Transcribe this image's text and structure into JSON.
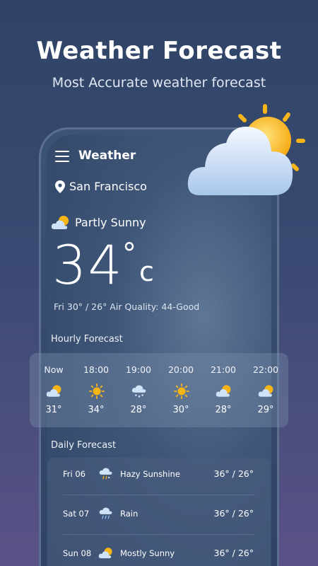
{
  "promo": {
    "title": "Weather Forecast",
    "subtitle": "Most Accurate weather forecast"
  },
  "app": {
    "title": "Weather",
    "location": "San Francisco",
    "condition": "Partly Sunny",
    "temperature": "34",
    "degree_symbol": "°",
    "unit": "c",
    "details": "Fri 30° / 26°  Air Quality: 44-Good"
  },
  "hourly": {
    "label": "Hourly Forecast",
    "items": [
      {
        "time": "Now",
        "icon": "partly-sunny-icon",
        "temp": "31°"
      },
      {
        "time": "18:00",
        "icon": "sun-icon",
        "temp": "34°"
      },
      {
        "time": "19:00",
        "icon": "snow-cloud-icon",
        "temp": "28°"
      },
      {
        "time": "20:00",
        "icon": "sun-icon",
        "temp": "30°"
      },
      {
        "time": "21:00",
        "icon": "partly-sunny-icon",
        "temp": "28°"
      },
      {
        "time": "22:00",
        "icon": "partly-sunny-icon",
        "temp": "29°"
      }
    ]
  },
  "daily": {
    "label": "Daily Forecast",
    "items": [
      {
        "day": "Fri 06",
        "icon": "hazy-sunshine-icon",
        "condition": "Hazy Sunshine",
        "temps": "36° / 26°"
      },
      {
        "day": "Sat 07",
        "icon": "rain-icon",
        "condition": "Rain",
        "temps": "36° / 26°"
      },
      {
        "day": "Sun 08",
        "icon": "mostly-sunny-icon",
        "condition": "Mostly Sunny",
        "temps": "36° / 26°"
      }
    ]
  },
  "colors": {
    "sun": "#f6b417",
    "cloud": "#cfe2f7",
    "background_top": "#2f4467",
    "background_bottom": "#5a5287"
  }
}
